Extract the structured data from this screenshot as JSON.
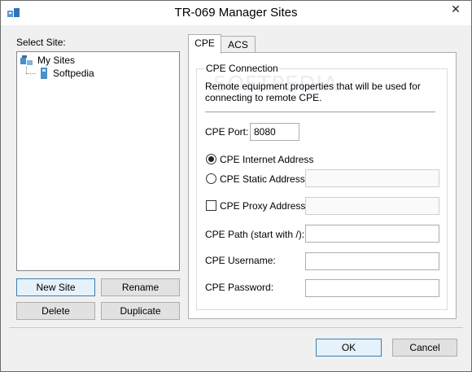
{
  "window": {
    "title": "TR-069 Manager Sites",
    "close_glyph": "✕"
  },
  "left": {
    "select_label": "Select Site:",
    "tree": {
      "root": "My Sites",
      "children": [
        "Softpedia"
      ]
    },
    "buttons": {
      "new_site": "New Site",
      "rename": "Rename",
      "delete": "Delete",
      "duplicate": "Duplicate"
    }
  },
  "tabs": [
    {
      "label": "CPE",
      "active": true
    },
    {
      "label": "ACS",
      "active": false
    }
  ],
  "cpe": {
    "group_title": "CPE Connection",
    "description": "Remote equipment properties that will be used for connecting to remote CPE.",
    "port_label": "CPE Port:",
    "port_value": "8080",
    "internet_address_label": "CPE Internet Address",
    "internet_address_selected": true,
    "static_address_label": "CPE Static Address:",
    "static_address_value": "",
    "proxy_address_label": "CPE Proxy Address:",
    "proxy_address_checked": false,
    "proxy_address_value": "",
    "path_label": "CPE Path (start with /):",
    "path_value": "",
    "username_label": "CPE Username:",
    "username_value": "",
    "password_label": "CPE Password:",
    "password_value": ""
  },
  "footer": {
    "ok": "OK",
    "cancel": "Cancel"
  },
  "icons": [
    "app-icon",
    "close-icon",
    "sites-folder-icon",
    "site-icon"
  ],
  "colors": {
    "focus_border": "#3c7fb1",
    "button_face": "#e1e1e1",
    "dialog_bg": "#f0f0f0"
  }
}
